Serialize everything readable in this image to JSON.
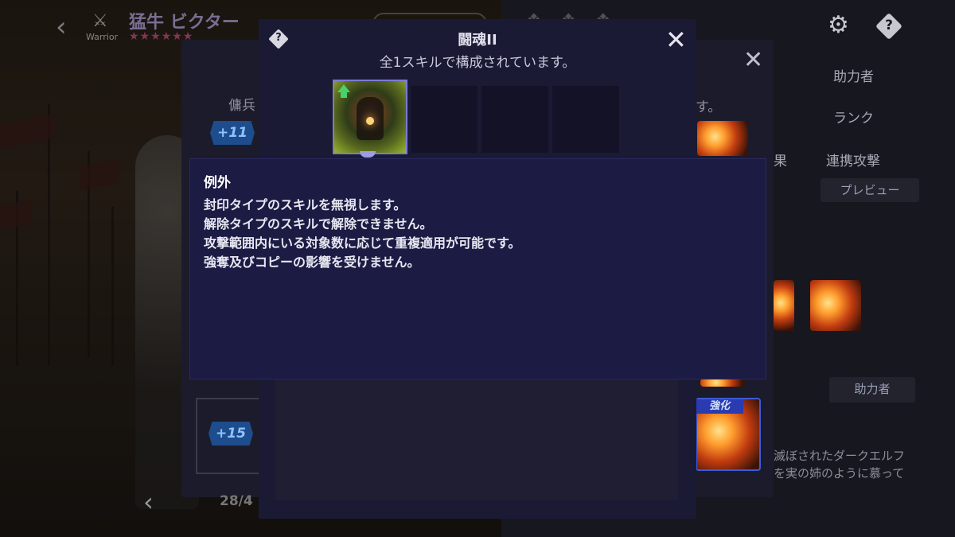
{
  "hero": {
    "class_label": "Warrior",
    "class_icon": "sword-icon",
    "name": "猛牛 ビクター",
    "stars": "★★★★★★"
  },
  "top_right": {
    "gear_icon": "gear-sort-icon",
    "help_icon": "help-diamond-icon",
    "help_symbol": "?"
  },
  "right_menu": {
    "helper": "助力者",
    "rank": "ランク",
    "effect_fragment": "果",
    "chain_attack": "連携攻撃",
    "preview_button": "プレビュー",
    "helper_button": "助力者",
    "desc_line1": "滅ぼされたダークエルフ",
    "desc_line2": "を実の姉のように慕って"
  },
  "mid_panel": {
    "heading_fragment": "傭兵",
    "suffix_fragment": "す。",
    "badge_top": "+11",
    "badge_bottom": "+15",
    "enhance_tag": "強化",
    "level_fragment": "28/4",
    "close_symbol": "✕"
  },
  "modal": {
    "help_symbol": "?",
    "title": "闘魂II",
    "subtitle": "全1スキルで構成されています。",
    "close_symbol": "✕"
  },
  "tooltip": {
    "heading": "例外",
    "lines": [
      "封印タイプのスキルを無視します。",
      "解除タイプのスキルで解除できません。",
      "攻撃範囲内にいる対象数に応じて重複適用が可能です。",
      "強奪及びコピーの影響を受けません。"
    ]
  },
  "colors": {
    "modal_bg": "#1b1a35",
    "tooltip_bg": "#1c1b43",
    "skill_border": "#7c7ad6",
    "badge_blue": "#1d4d8c",
    "star_pink": "#ff5fa8"
  }
}
